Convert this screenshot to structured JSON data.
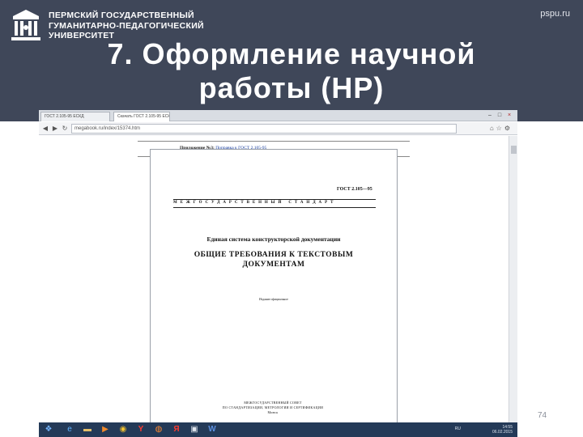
{
  "header": {
    "university_lines": [
      "ПЕРМСКИЙ ГОСУДАРСТВЕННЫЙ",
      "ГУМАНИТАРНО-ПЕДАГОГИЧЕСКИЙ",
      "УНИВЕРСИТЕТ"
    ],
    "site": "pspu.ru",
    "title_lines": [
      "7. Оформление научной",
      "работы (НР)"
    ],
    "logo_icon": "university-emblem-icon"
  },
  "browser": {
    "tabs": [
      "ГОСТ 2.105-95 ЕСКД",
      "Скачать ГОСТ 2.105-95 ЕСКД"
    ],
    "address": "megabook.ru/index/15374.htm",
    "icons": [
      "back-icon",
      "forward-icon",
      "home-icon",
      "star-icon",
      "gear-icon"
    ]
  },
  "document_page": {
    "appendix_label": "Приложение №3:",
    "appendix_link": "Поправка к ГОСТ 2.105-95",
    "gost_number": "ГОСТ 2.105—95",
    "standard_line": "МЕЖГОСУДАРСТВЕННЫЙ СТАНДАРТ",
    "system": "Единая система конструкторской документации",
    "title_lines": [
      "ОБЩИЕ ТРЕБОВАНИЯ К ТЕКСТОВЫМ",
      "ДОКУМЕНТАМ"
    ],
    "official_edition": "Издание официальное",
    "publisher_lines": [
      "МЕЖГОСУДАРСТВЕННЫЙ СОВЕТ",
      "ПО СТАНДАРТИЗАЦИИ, МЕТРОЛОГИИ И СЕРТИФИКАЦИИ",
      "Минск"
    ]
  },
  "taskbar": {
    "lang": "RU",
    "time": "14:55",
    "date": "06.02.2015"
  },
  "page_number": "74",
  "colors": {
    "header_bg": "#3f4759",
    "taskbar_bg": "#243a58"
  }
}
